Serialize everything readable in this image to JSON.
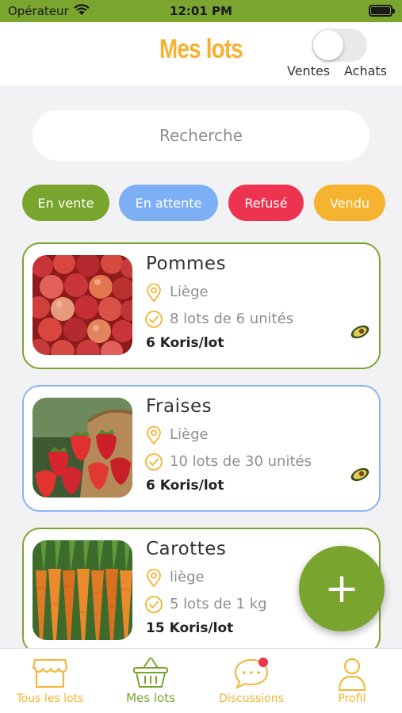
{
  "status_bar": {
    "carrier": "Opérateur",
    "time": "12:01 PM"
  },
  "header": {
    "title": "Mes lots",
    "toggle": {
      "left_label": "Ventes",
      "right_label": "Achats",
      "state": "off"
    }
  },
  "search": {
    "placeholder": "Recherche",
    "value": ""
  },
  "filters": [
    {
      "label": "En vente",
      "color": "#79a52f"
    },
    {
      "label": "En attente",
      "color": "#7daff4"
    },
    {
      "label": "Refusé",
      "color": "#ec3450"
    },
    {
      "label": "Vendu",
      "color": "#f6b330"
    }
  ],
  "lots": [
    {
      "name": "Pommes",
      "location": "Liège",
      "quantity": "8 lots de 6 unités",
      "price": "6 Koris/lot",
      "status_color": "#7aa630",
      "image": "apples-photo"
    },
    {
      "name": "Fraises",
      "location": "Liège",
      "quantity": "10 lots de 30 unités",
      "price": "6 Koris/lot",
      "status_color": "#8ab4f6",
      "image": "strawberries-photo"
    },
    {
      "name": "Carottes",
      "location": "liège",
      "quantity": "5 lots de 1 kg",
      "price": "15 Koris/lot",
      "status_color": "#7aa630",
      "image": "carrots-photo"
    }
  ],
  "fab": {
    "label": "+"
  },
  "tabbar": [
    {
      "label": "Tous les lots",
      "icon": "shop-icon",
      "active": false
    },
    {
      "label": "Mes lots",
      "icon": "basket-icon",
      "active": true
    },
    {
      "label": "Discussions",
      "icon": "chat-bubble-icon",
      "active": false,
      "badge": true
    },
    {
      "label": "Profil",
      "icon": "person-icon",
      "active": false
    }
  ],
  "colors": {
    "primary_green": "#79a52f",
    "accent_orange": "#f6b330",
    "pending_blue": "#7daff4",
    "refused_red": "#ec3450"
  }
}
